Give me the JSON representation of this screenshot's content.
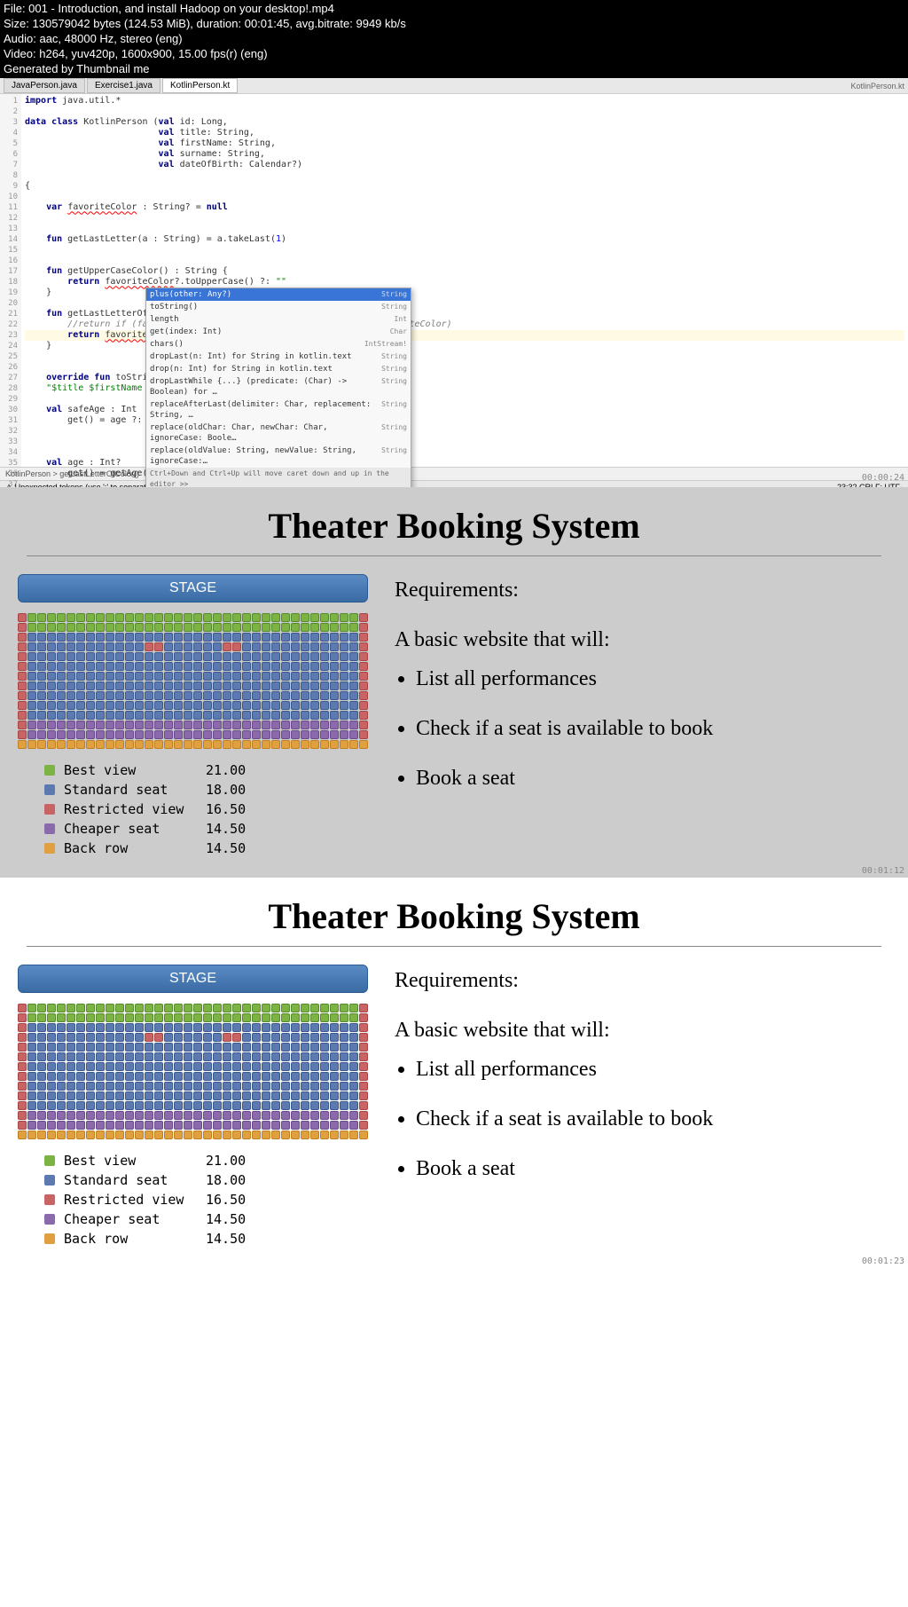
{
  "info": {
    "file": "File: 001 - Introduction, and install Hadoop on your desktop!.mp4",
    "size": "Size: 130579042 bytes (124.53 MiB), duration: 00:01:45, avg.bitrate: 9949 kb/s",
    "audio": "Audio: aac, 48000 Hz, stereo (eng)",
    "video": "Video: h264, yuv420p, 1600x900, 15.00 fps(r) (eng)",
    "gen": "Generated by Thumbnail me"
  },
  "ide": {
    "tabs": [
      "JavaPerson.java",
      "Exercise1.java",
      "KotlinPerson.kt"
    ],
    "active_tab": "KotlinPerson.kt",
    "top_right": "KotlinPerson.kt",
    "breadcrumb": "KotlinPerson > getLastLetterOfColor()",
    "status_left": "Unexpected tokens (use ';' to separate expressions on the same line)",
    "status_right": "23:32  CRLF:  UTF-",
    "timestamp_top": "00:00:24",
    "autocomplete": [
      {
        "label": "plus(other: Any?)",
        "type": "String"
      },
      {
        "label": "toString()",
        "type": "String"
      },
      {
        "label": "length",
        "type": "Int"
      },
      {
        "label": "get(index: Int)",
        "type": "Char"
      },
      {
        "label": "chars()",
        "type": "IntStream!"
      },
      {
        "label": "dropLast(n: Int) for String in kotlin.text",
        "type": "String"
      },
      {
        "label": "drop(n: Int) for String in kotlin.text",
        "type": "String"
      },
      {
        "label": "dropLastWhile {...} (predicate: (Char) -> Boolean) for …",
        "type": "String"
      },
      {
        "label": "replaceAfterLast(delimiter: Char, replacement: String, …",
        "type": "String"
      },
      {
        "label": "replace(oldChar: Char, newChar: Char, ignoreCase: Boole…",
        "type": "String"
      },
      {
        "label": "replace(oldValue: String, newValue: String, ignoreCase:…",
        "type": "String"
      }
    ],
    "ac_hint": "Ctrl+Down and Ctrl+Up will move caret down and up in the editor >>"
  },
  "slide": {
    "title": "Theater Booking System",
    "stage": "STAGE",
    "legend": [
      {
        "color": "g",
        "label": "Best view",
        "price": "21.00"
      },
      {
        "color": "b",
        "label": "Standard seat",
        "price": "18.00"
      },
      {
        "color": "r",
        "label": "Restricted view",
        "price": "16.50"
      },
      {
        "color": "p",
        "label": "Cheaper seat",
        "price": "14.50"
      },
      {
        "color": "o",
        "label": "Back row",
        "price": "14.50"
      }
    ],
    "req_title": "Requirements:",
    "req_intro": "A basic website that will:",
    "reqs": [
      "List all performances",
      "Check if a seat is available to book",
      "Book a seat"
    ],
    "timestamp1": "00:01:12",
    "timestamp2": "00:01:23"
  }
}
